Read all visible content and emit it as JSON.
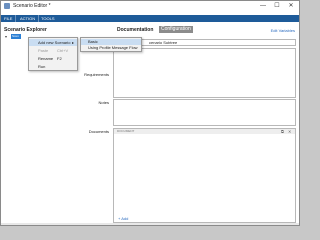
{
  "window": {
    "title": "Scenario Editor *",
    "controls": {
      "minimize": "—",
      "maximize": "☐",
      "close": "✕"
    }
  },
  "menubar": {
    "items": [
      {
        "label": "FILE"
      },
      {
        "label": "ACTION"
      },
      {
        "label": "TOOLS"
      }
    ]
  },
  "explorer": {
    "title": "Scenario Explorer",
    "tree": {
      "expander": "▾",
      "node_label": "Scen"
    }
  },
  "context_menu": {
    "items": [
      {
        "label": "Add new Scenario",
        "submenu": "▸",
        "highlighted": true,
        "enabled": true
      },
      {
        "label": "Paste",
        "shortcut": "Ctrl+V",
        "enabled": false
      },
      {
        "label": "Rename",
        "shortcut": "F2",
        "enabled": true
      },
      {
        "label": "Run",
        "enabled": true
      }
    ],
    "submenu": {
      "items": [
        {
          "label": "Basic",
          "highlighted": true
        },
        {
          "label": "Using Profile Message Flow"
        }
      ]
    }
  },
  "details": {
    "title": "Documentation",
    "active_tab": "Configuration",
    "edit_link": "Edit Variables",
    "name_value": "cenario Subtree",
    "fields": {
      "requirements": "Requirements",
      "notes": "Notes",
      "documents": "Documents"
    },
    "documents": {
      "header": "DOCUMENT",
      "icons": [
        "copy-icon",
        "close-icon"
      ],
      "add_label": "+ Add"
    }
  }
}
